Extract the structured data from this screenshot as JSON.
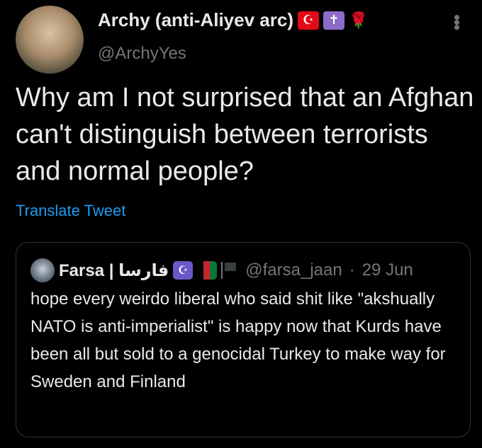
{
  "tweet": {
    "author_name": "Archy (anti-Aliyev arc)",
    "author_handle": "@ArchyYes",
    "badges": [
      "turkey-flag",
      "cross-emoji",
      "rose-emoji"
    ],
    "text": "Why am I not surprised that an Afghan can't distinguish between terrorists and normal people?",
    "translate_label": "Translate Tweet"
  },
  "quoted": {
    "author_name": "Farsa | فارسا",
    "badges": [
      "star-crescent-emoji",
      "afghanistan-flag",
      "black-flag"
    ],
    "author_handle": "@farsa_jaan",
    "separator": "·",
    "date": "29 Jun",
    "text": "hope every weirdo liberal who said shit like \"akshually NATO is anti-imperialist\" is happy now that Kurds have been all but sold to a genocidal Turkey to make way for Sweden and Finland"
  }
}
